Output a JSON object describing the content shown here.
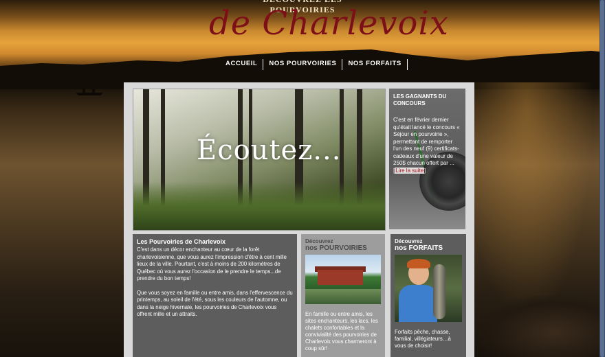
{
  "header": {
    "tagline": "DÉCOUVREZ LES POURVOIRIES",
    "logo": "de Charlevoix"
  },
  "nav": {
    "items": [
      {
        "label": "ACCUEIL"
      },
      {
        "label": "NOS POURVOIRIES"
      },
      {
        "label": "NOS FORFAITS"
      }
    ]
  },
  "hero": {
    "text": "Écoutez..."
  },
  "sidebar": {
    "title": "LES GAGNANTS DU CONCOURS",
    "body": "C'est en février dernier qu'était lancé le concours « Séjour en pourvoirie », permettant de remporter l'un des neuf (9) certificats-cadeaux d'une valeur de 250$ chacun offert par ...",
    "link_open": "[",
    "link": "Lire la suite",
    "link_close": "]"
  },
  "intro": {
    "title": "Les Pourvoiries de Charlevoix",
    "para1": "C'est dans un décor enchanteur au cœur de la forêt charlevoisienne, que vous aurez l'impression d'être à cent mille lieux de la ville. Pourtant, c'est à moins de 200 kilomètres de Québec où vous aurez l'occasion de le prendre le temps...de prendre du bon temps!",
    "para2": "Que vous soyez en famille ou entre amis, dans l'effervescence du printemps, au soleil de l'été, sous les couleurs de l'automne, ou dans la neige hivernale, les pourvoiries de Charlevoix vous offrent mille et un attraits."
  },
  "pourvoiries": {
    "small": "Découvrez",
    "big": "nos POURVOIRIES",
    "text": "En famille ou entre amis, les sites enchanteurs, les lacs, les chalets confortables et la convivialité des pourvoiries de Charlevoix vous charmeront à coup sûr!"
  },
  "forfaits": {
    "small": "Découvrez",
    "big": "nos FORFAITS",
    "text": "Forfaits pêche, chasse, familial, villégiateurs…à vous de choisir!"
  }
}
